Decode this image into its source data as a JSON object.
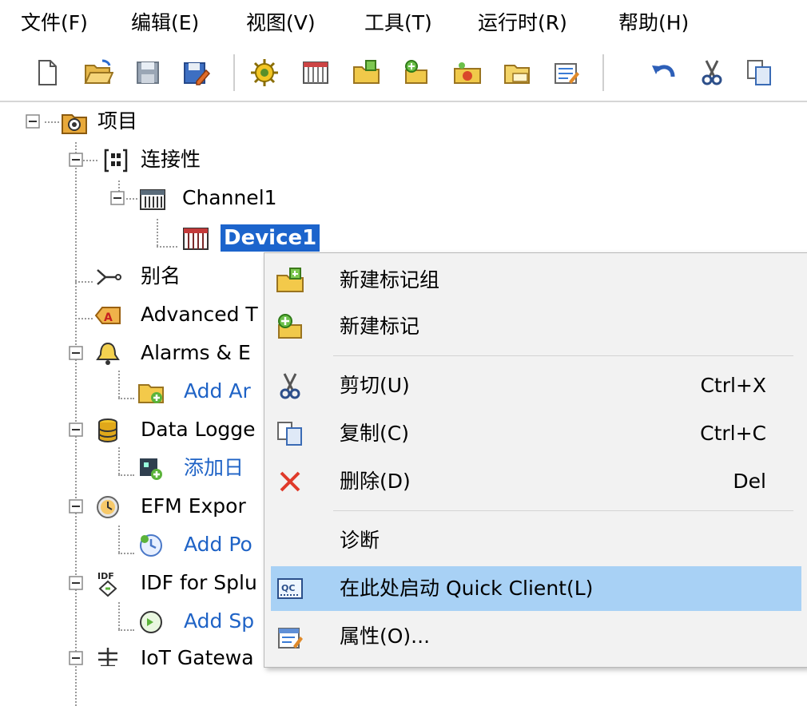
{
  "menubar": {
    "file": "文件(F)",
    "edit": "编辑(E)",
    "view": "视图(V)",
    "tools": "工具(T)",
    "runtime": "运行时(R)",
    "help": "帮助(H)"
  },
  "toolbar": {
    "buttons": [
      "new-file-icon",
      "open-folder-icon",
      "save-icon",
      "save-as-icon",
      "connectivity-gear-icon",
      "device-icon",
      "tag-group-icon",
      "tag-icon",
      "bulk-tag-icon",
      "folder-tag-icon",
      "properties-icon",
      "undo-icon",
      "cut-icon",
      "copy-icon"
    ]
  },
  "tree": {
    "project": "项目",
    "connectivity": "连接性",
    "channel1": "Channel1",
    "device1": "Device1",
    "aliases": "别名",
    "advanced_tags": "Advanced T",
    "alarms": "Alarms & E",
    "add_area": "Add Ar",
    "data_logger": "Data Logge",
    "add_log": "添加日",
    "efm_exporter": "EFM Expor",
    "add_poll": "Add Po",
    "idf_splunk": "IDF for Splu",
    "add_splunk": "Add Sp",
    "iot_gateway": "IoT Gatewa"
  },
  "context_menu": {
    "new_tag_group": "新建标记组",
    "new_tag": "新建标记",
    "cut": "剪切(U)",
    "cut_shortcut": "Ctrl+X",
    "copy": "复制(C)",
    "copy_shortcut": "Ctrl+C",
    "delete": "删除(D)",
    "delete_shortcut": "Del",
    "diagnostics": "诊断",
    "quick_client": "在此处启动 Quick Client(L)",
    "properties": "属性(O)..."
  },
  "colors": {
    "selection": "#1c64cc",
    "menu_highlight": "#a8d1f5",
    "link_text": "#1f63c6",
    "menu_background": "#f2f2f2"
  }
}
